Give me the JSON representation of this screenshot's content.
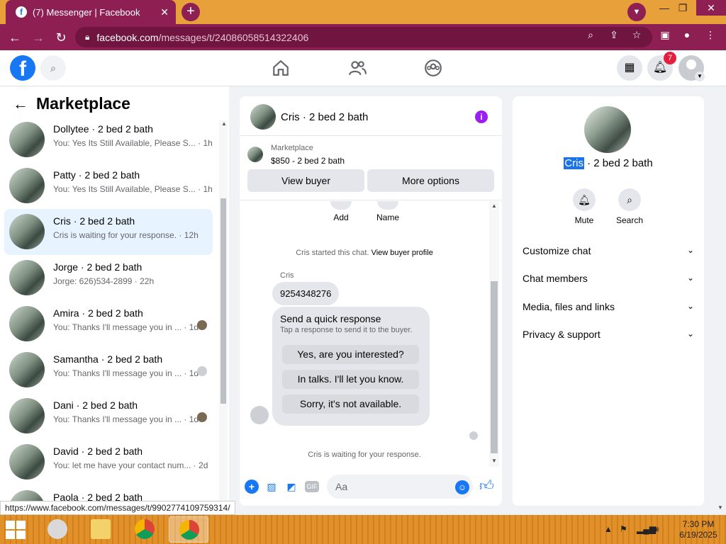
{
  "browser": {
    "tab_title": "(7) Messenger | Facebook",
    "tab_favicon": "f",
    "url_host": "facebook.com",
    "url_path": "/messages/t/24086058514322406",
    "status_url": "https://www.facebook.com/messages/t/9902774109759314/"
  },
  "fb": {
    "logo": "f",
    "notification_count": "7"
  },
  "left": {
    "title": "Marketplace",
    "conversations": [
      {
        "name": "Dollytee · 2 bed 2 bath",
        "snippet": "You: Yes Its Still Available, Please S...",
        "time": "1h"
      },
      {
        "name": "Patty · 2 bed 2 bath",
        "snippet": "You: Yes Its Still Available, Please S...",
        "time": "1h"
      },
      {
        "name": "Cris · 2 bed 2 bath",
        "snippet": "Cris is waiting for your response.",
        "time": "12h"
      },
      {
        "name": "Jorge · 2 bed 2 bath",
        "snippet": "Jorge: 626)534-2899",
        "time": "22h"
      },
      {
        "name": "Amira · 2 bed 2 bath",
        "snippet": "You: Thanks I'll message you in ...",
        "time": "1d"
      },
      {
        "name": "Samantha · 2 bed 2 bath",
        "snippet": "You: Thanks I'll message you in ...",
        "time": "1d"
      },
      {
        "name": "Dani · 2 bed 2 bath",
        "snippet": "You: Thanks I'll message you in ...",
        "time": "1d"
      },
      {
        "name": "David · 2 bed 2 bath",
        "snippet": "You: let me have your contact num...",
        "time": "2d"
      },
      {
        "name": "Paola · 2 bed 2 bath",
        "snippet": "",
        "time": ""
      }
    ]
  },
  "chat": {
    "header_name": "Cris · 2 bed 2 bath",
    "listing_label": "Marketplace",
    "listing_price": "$850 - 2 bed 2 bath",
    "view_buyer": "View buyer",
    "more_options": "More options",
    "action_add": "Add",
    "action_name": "Name",
    "started_text": "Cris started this chat.",
    "view_buyer_profile": "View buyer profile",
    "sender": "Cris",
    "message": "9254348276",
    "qr_title": "Send a quick response",
    "qr_subtitle": "Tap a response to send it to the buyer.",
    "qr_options": [
      "Yes, are you interested?",
      "In talks. I'll let you know.",
      "Sorry, it's not available."
    ],
    "waiting_text": "Cris is waiting for your response.",
    "input_placeholder": "Aa",
    "gif_label": "GIF"
  },
  "right": {
    "name_highlight": "Cris",
    "name_rest": " · 2 bed 2 bath",
    "mute": "Mute",
    "search": "Search",
    "rows": [
      "Customize chat",
      "Chat members",
      "Media, files and links",
      "Privacy & support"
    ]
  },
  "taskbar": {
    "time": "7:30 PM",
    "date": "6/19/2025"
  },
  "colors": {
    "chrome_accent": "#8d1f52",
    "tabbar": "#e8a13a",
    "fb_blue": "#1877f2",
    "info_purple": "#9b1ff0",
    "badge_red": "#e41e3f",
    "taskbar": "#e0912a"
  }
}
